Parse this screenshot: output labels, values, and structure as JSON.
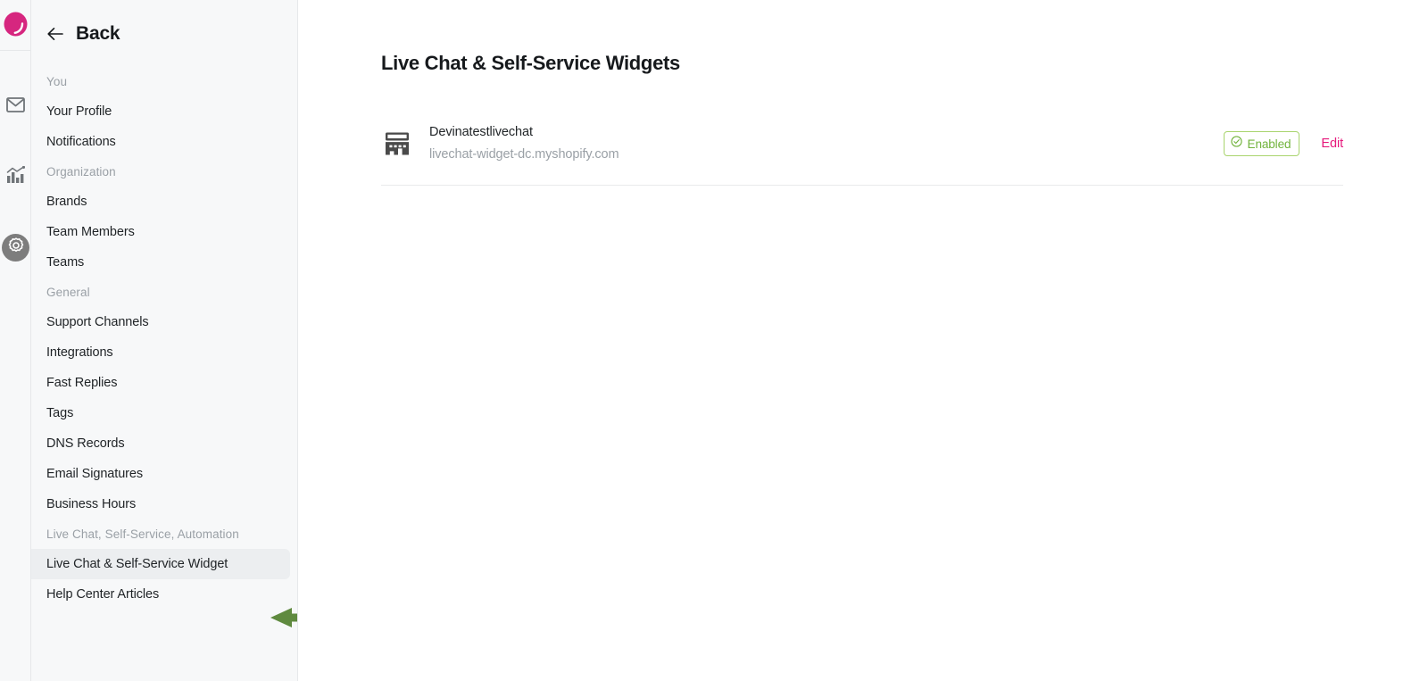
{
  "rail": {
    "logo_icon": "brand-logo-icon",
    "items": [
      {
        "icon": "mail-icon",
        "name": "inbox",
        "active": false
      },
      {
        "icon": "reports-icon",
        "name": "reports",
        "active": false
      },
      {
        "icon": "gear-icon",
        "name": "settings",
        "active": true
      }
    ]
  },
  "sidebar": {
    "back_label": "Back",
    "back_icon": "arrow-left-icon",
    "groups": [
      {
        "title": "You",
        "items": [
          {
            "label": "Your Profile",
            "active": false
          },
          {
            "label": "Notifications",
            "active": false
          }
        ]
      },
      {
        "title": "Organization",
        "items": [
          {
            "label": "Brands",
            "active": false
          },
          {
            "label": "Team Members",
            "active": false
          },
          {
            "label": "Teams",
            "active": false
          }
        ]
      },
      {
        "title": "General",
        "items": [
          {
            "label": "Support Channels",
            "active": false
          },
          {
            "label": "Integrations",
            "active": false
          },
          {
            "label": "Fast Replies",
            "active": false
          },
          {
            "label": "Tags",
            "active": false
          },
          {
            "label": "DNS Records",
            "active": false
          },
          {
            "label": "Email Signatures",
            "active": false
          },
          {
            "label": "Business Hours",
            "active": false
          }
        ]
      },
      {
        "title": "Live Chat, Self-Service, Automation",
        "items": [
          {
            "label": "Live Chat & Self-Service Widget",
            "active": true
          },
          {
            "label": "Help Center Articles",
            "active": false
          }
        ]
      }
    ]
  },
  "main": {
    "title": "Live Chat & Self-Service Widgets",
    "widgets": [
      {
        "icon": "storefront-icon",
        "name": "Devinatestlivechat",
        "url": "livechat-widget-dc.myshopify.com",
        "status_label": "Enabled",
        "status_icon": "check-circle-icon",
        "edit_label": "Edit"
      }
    ]
  },
  "annotations": [
    {
      "name": "sidebar-arrow",
      "points_to": "Live Chat & Self-Service Widget"
    },
    {
      "name": "edit-arrow",
      "points_to": "Edit"
    }
  ],
  "colors": {
    "brand_pink": "#d6267f",
    "edit_link": "#e6197c",
    "status_green": "#71b33c",
    "status_border": "#a9d46e",
    "annotation_green": "#5f8a3f",
    "sidebar_bg": "#f7f8f9",
    "active_item_bg": "#eceef0"
  }
}
